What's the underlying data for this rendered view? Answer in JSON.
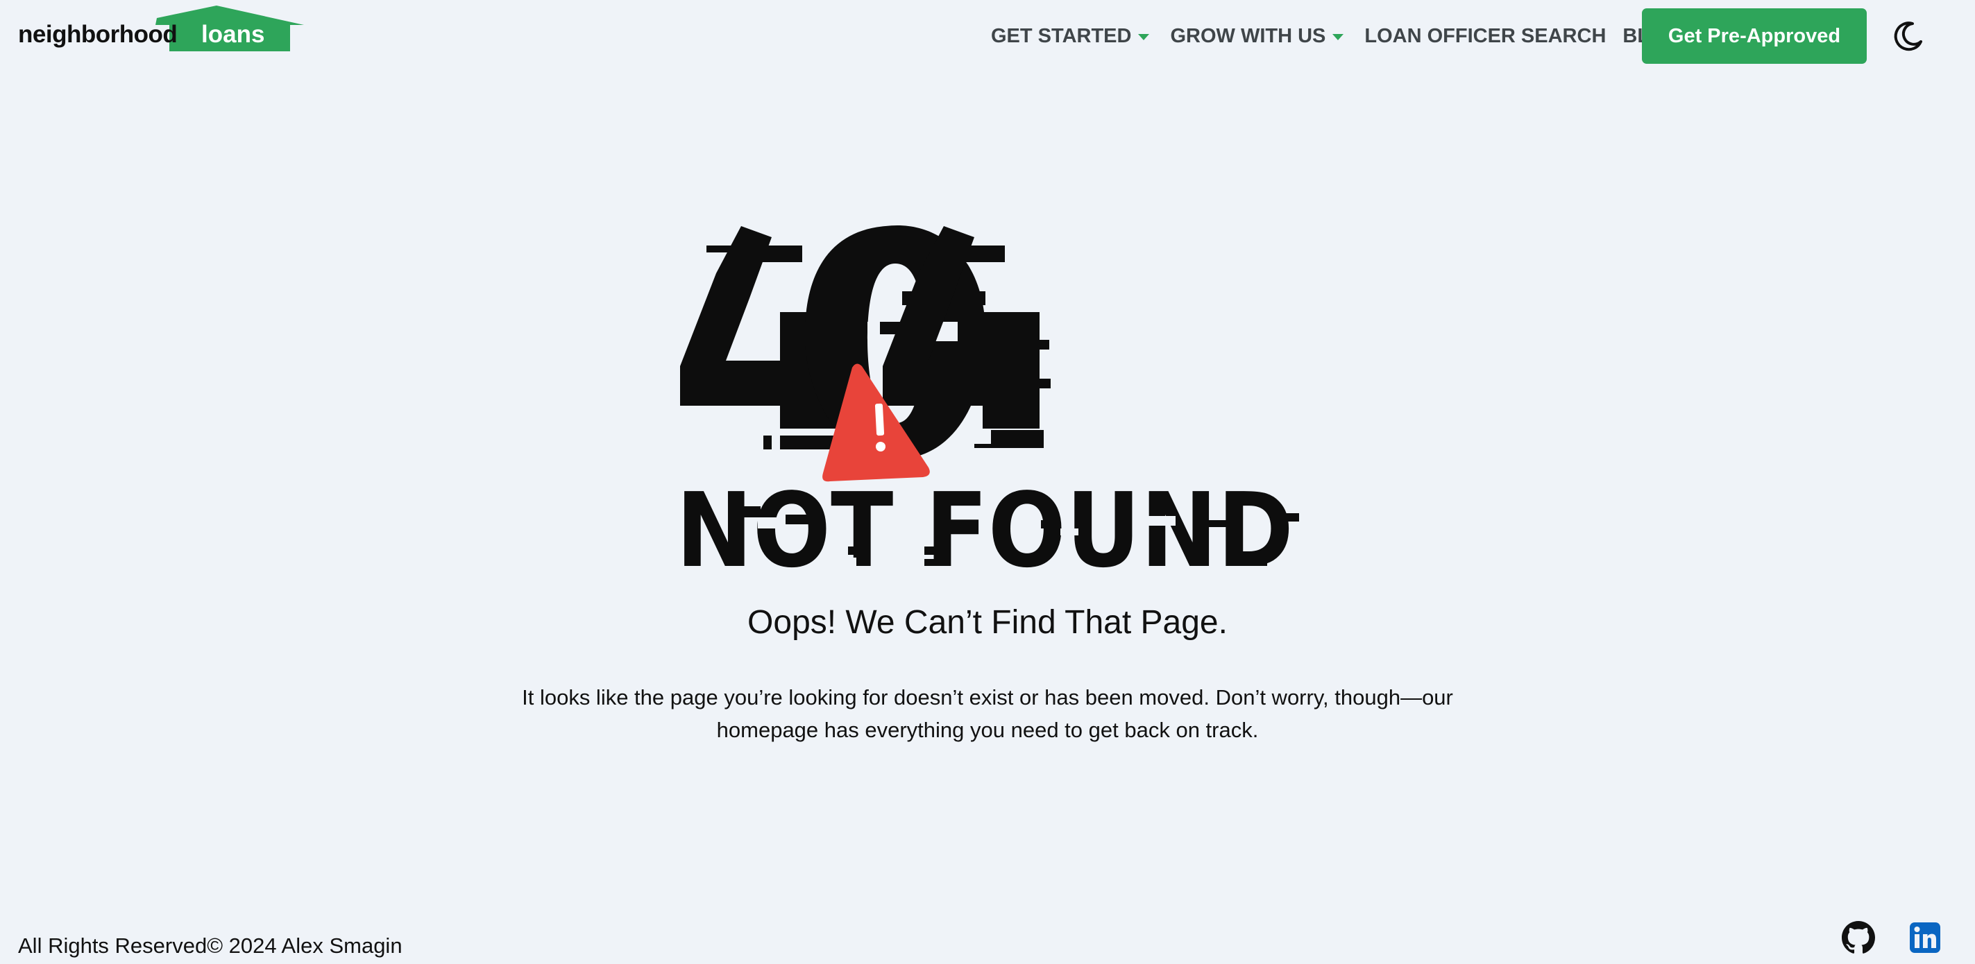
{
  "header": {
    "logo": {
      "word1": "neighborhood",
      "word2": "loans",
      "house_color": "#2ea55a"
    },
    "nav": [
      {
        "label": "GET STARTED",
        "has_dropdown": true
      },
      {
        "label": "GROW WITH US",
        "has_dropdown": true
      },
      {
        "label": "LOAN OFFICER SEARCH",
        "has_dropdown": false
      },
      {
        "label": "BLOG",
        "has_dropdown": false
      }
    ],
    "cta_label": "Get Pre-Approved",
    "theme_toggle_icon": "moon-icon"
  },
  "hero": {
    "code": "404",
    "subtitle": "NOT FOUND",
    "warning_icon": "warning-triangle-icon",
    "warning_color": "#e8443a"
  },
  "content": {
    "heading": "Oops! We Can’t Find That Page.",
    "body": "It looks like the page you’re looking for doesn’t exist or has been moved. Don’t worry, though—our homepage has everything you need to get back on track."
  },
  "footer": {
    "copyright": "All Rights Reserved© 2024 Alex Smagin",
    "icons": [
      "github-icon",
      "linkedin-icon"
    ],
    "linkedin_color": "#0a66c2"
  },
  "colors": {
    "background": "#eff3f8",
    "accent": "#2ea55a",
    "text": "#111111",
    "nav_text": "#3f4549"
  }
}
